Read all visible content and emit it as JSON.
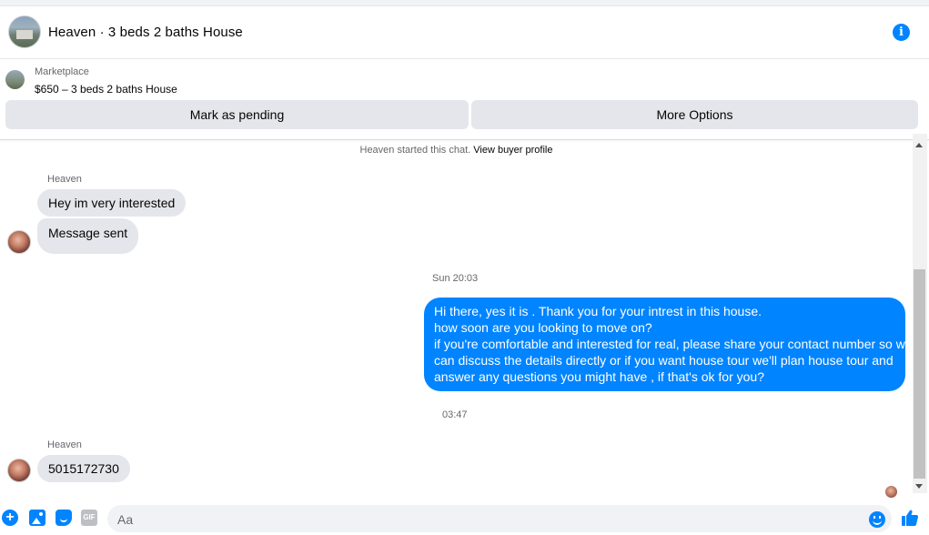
{
  "header": {
    "title": "Heaven · 3 beds 2 baths House",
    "info_icon": "info-icon"
  },
  "marketplace": {
    "label": "Marketplace",
    "listing": "$650 – 3 beds 2 baths House",
    "buttons": {
      "mark_pending": "Mark as pending",
      "more_options": "More Options"
    }
  },
  "chat": {
    "started_text": "Heaven started this chat.",
    "buyer_profile_link": "View buyer profile",
    "groups": [
      {
        "sender": "Heaven",
        "messages": [
          "Hey im very interested",
          "Message sent"
        ]
      }
    ],
    "timestamp_1": "Sun 20:03",
    "outgoing_lines": [
      "Hi there, yes it is . Thank you for your intrest in this house.",
      "how soon are you looking to move on?",
      "if you're comfortable and interested for real, please share your contact number so we",
      "can discuss the details directly or if you  want house tour we'll plan house tour and",
      "answer any questions you might have , if that's ok for you?"
    ],
    "timestamp_2": "03:47",
    "reply": {
      "sender": "Heaven",
      "message": "5015172730"
    }
  },
  "composer": {
    "placeholder": "Aa",
    "icons": [
      "plus-icon",
      "photo-icon",
      "sticker-icon",
      "gif-icon",
      "emoji-icon",
      "like-icon"
    ],
    "gif_label": "GIF"
  },
  "colors": {
    "accent": "#0084ff",
    "bubble_in": "#e4e6eb",
    "button_bg": "#e4e6eb"
  }
}
